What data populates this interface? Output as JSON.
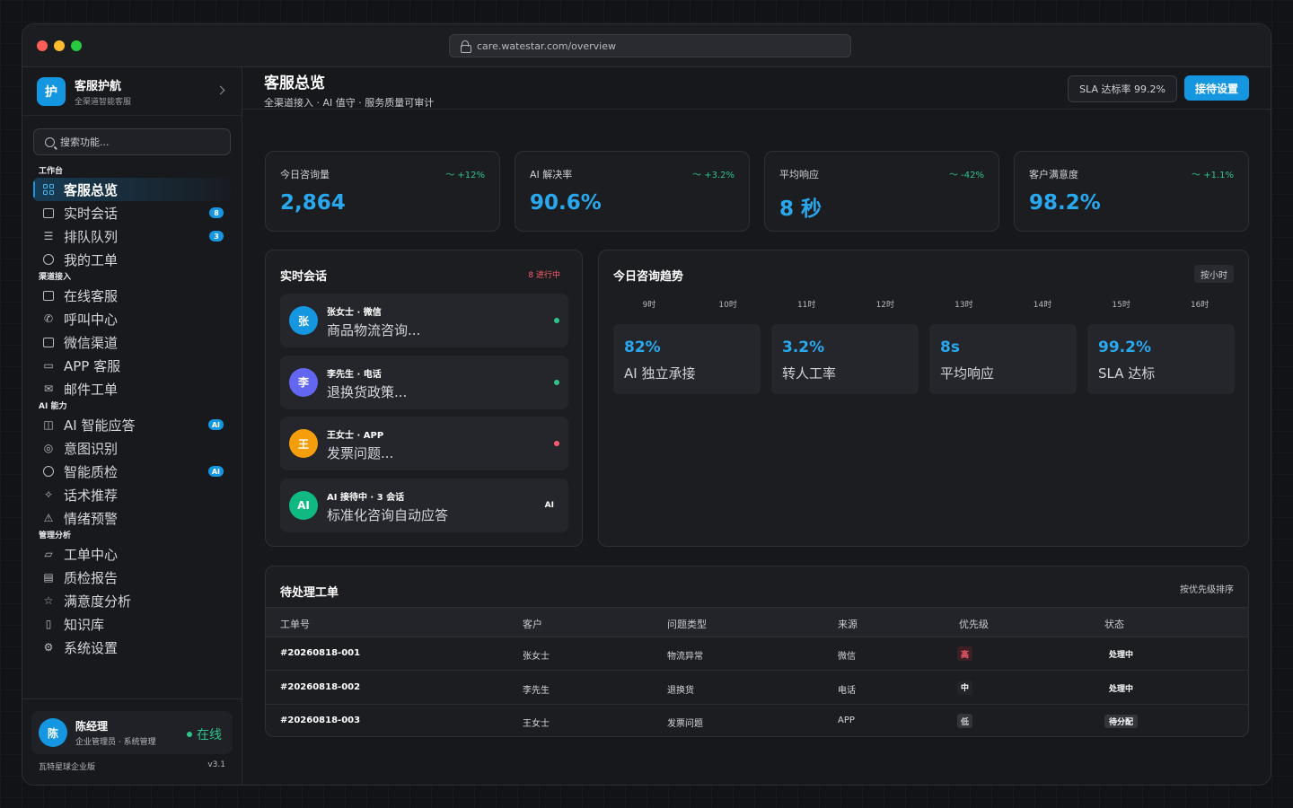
{
  "browser": {
    "url": "care.watestar.com/overview"
  },
  "brand": {
    "logo": "护",
    "name": "客服护航",
    "subtitle": "全渠道智能客服"
  },
  "search": {
    "placeholder": "搜索功能..."
  },
  "sidebar": {
    "sections": [
      {
        "title": "工作台",
        "items": [
          {
            "label": "客服总览",
            "icon": "grid-icon",
            "active": true
          },
          {
            "label": "实时会话",
            "icon": "chat-icon",
            "badge": "8"
          },
          {
            "label": "排队队列",
            "icon": "list-icon",
            "badge": "3"
          },
          {
            "label": "我的工单",
            "icon": "check-circle-icon"
          }
        ]
      },
      {
        "title": "渠道接入",
        "items": [
          {
            "label": "在线客服",
            "icon": "chat-icon"
          },
          {
            "label": "呼叫中心",
            "icon": "phone-icon"
          },
          {
            "label": "微信渠道",
            "icon": "chat-icon"
          },
          {
            "label": "APP 客服",
            "icon": "monitor-icon"
          },
          {
            "label": "邮件工单",
            "icon": "mail-icon"
          }
        ]
      },
      {
        "title": "AI 能力",
        "items": [
          {
            "label": "AI 智能应答",
            "icon": "robot-icon",
            "badge": "AI"
          },
          {
            "label": "意图识别",
            "icon": "target-icon"
          },
          {
            "label": "智能质检",
            "icon": "shield-icon",
            "badge": "AI"
          },
          {
            "label": "话术推荐",
            "icon": "sparkle-icon"
          },
          {
            "label": "情绪预警",
            "icon": "warning-icon"
          }
        ]
      },
      {
        "title": "管理分析",
        "items": [
          {
            "label": "工单中心",
            "icon": "folder-icon"
          },
          {
            "label": "质检报告",
            "icon": "report-icon"
          },
          {
            "label": "满意度分析",
            "icon": "star-icon"
          },
          {
            "label": "知识库",
            "icon": "book-icon"
          },
          {
            "label": "系统设置",
            "icon": "gear-icon"
          }
        ]
      }
    ]
  },
  "user": {
    "avatar": "陈",
    "name": "陈经理",
    "role": "企业管理员 · 系统管理",
    "status": "在线"
  },
  "footer": {
    "org": "瓦特星球企业版",
    "version": "v3.1"
  },
  "header": {
    "title": "客服总览",
    "subtitle": "全渠道接入 · AI 值守 · 服务质量可审计",
    "sla": "SLA 达标率 99.2%",
    "settings_button": "接待设置"
  },
  "kpis": [
    {
      "label": "今日咨询量",
      "delta": "+12%",
      "value": "2,864"
    },
    {
      "label": "AI 解决率",
      "delta": "+3.2%",
      "value": "90.6%"
    },
    {
      "label": "平均响应",
      "delta": "-42%",
      "value": "8 秒"
    },
    {
      "label": "客户满意度",
      "delta": "+1.1%",
      "value": "98.2%"
    }
  ],
  "sessions": {
    "title": "实时会话",
    "live": "8 进行中",
    "items": [
      {
        "avatar": "张",
        "name": "张女士 · 微信",
        "message": "商品物流咨询...",
        "color": "#1596e0",
        "dot": "#2fc58a"
      },
      {
        "avatar": "李",
        "name": "李先生 · 电话",
        "message": "退换货政策...",
        "color": "#6366f1",
        "dot": "#2fc58a"
      },
      {
        "avatar": "王",
        "name": "王女士 · APP",
        "message": "发票问题...",
        "color": "#f59e0b",
        "dot": "#ff5d6c"
      },
      {
        "avatar": "AI",
        "name": "AI 接待中 · 3 会话",
        "message": "标准化咨询自动应答",
        "color": "#10b981",
        "tag": "AI"
      }
    ]
  },
  "trend": {
    "title": "今日咨询趋势",
    "granularity": "按小时",
    "hours": [
      "9时",
      "10时",
      "11时",
      "12时",
      "13时",
      "14时",
      "15时",
      "16时"
    ],
    "metrics": [
      {
        "value": "82%",
        "label": "AI 独立承接"
      },
      {
        "value": "3.2%",
        "label": "转人工率"
      },
      {
        "value": "8s",
        "label": "平均响应"
      },
      {
        "value": "99.2%",
        "label": "SLA 达标"
      }
    ]
  },
  "tickets": {
    "title": "待处理工单",
    "sort": "按优先级排序",
    "columns": [
      "工单号",
      "客户",
      "问题类型",
      "来源",
      "优先级",
      "状态"
    ],
    "rows": [
      {
        "id": "#20260818-001",
        "customer": "张女士",
        "type": "物流异常",
        "source": "微信",
        "priority": "高",
        "status": "处理中"
      },
      {
        "id": "#20260818-002",
        "customer": "李先生",
        "type": "退换货",
        "source": "电话",
        "priority": "中",
        "status": "处理中"
      },
      {
        "id": "#20260818-003",
        "customer": "王女士",
        "type": "发票问题",
        "source": "APP",
        "priority": "低",
        "status": "待分配"
      }
    ]
  },
  "colors": {
    "accent": "#1596e0",
    "positive": "#2fc58a",
    "alert": "#ff5d6c"
  }
}
